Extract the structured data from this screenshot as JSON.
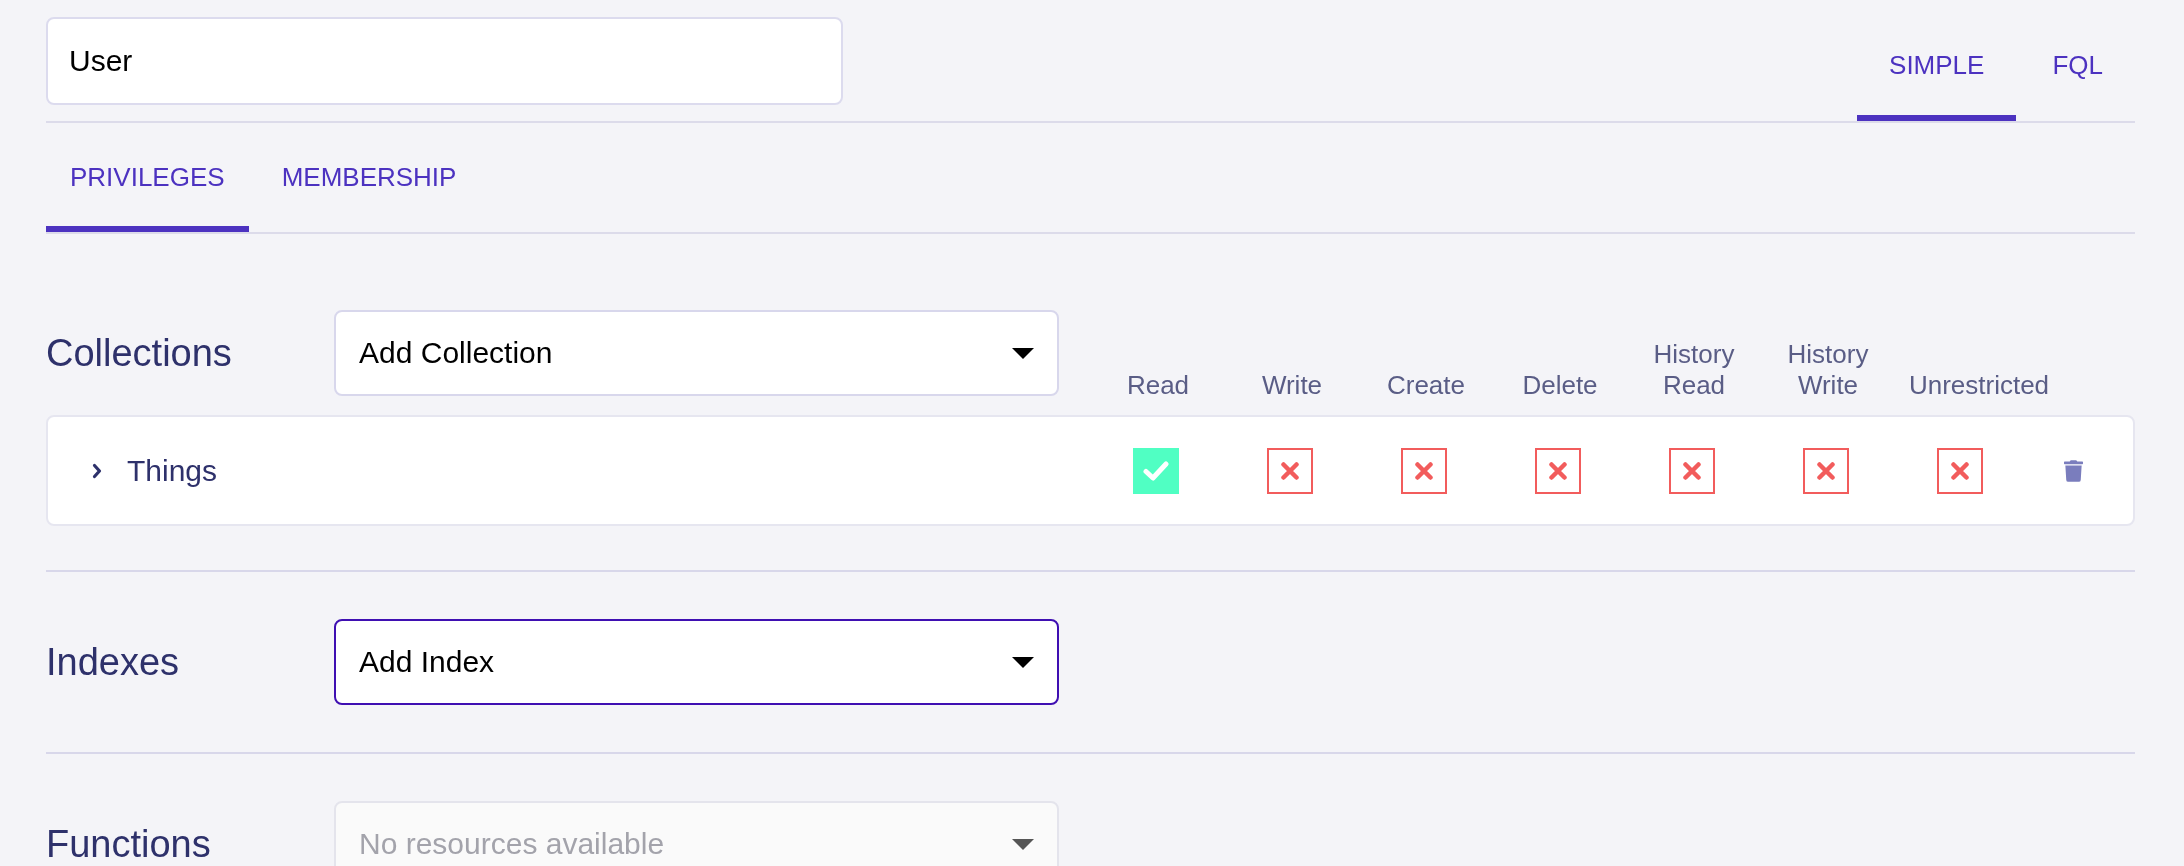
{
  "role_name": {
    "value": "User"
  },
  "mode_tabs": [
    {
      "label": "SIMPLE",
      "selected": true
    },
    {
      "label": "FQL",
      "selected": false
    }
  ],
  "tabs": [
    {
      "label": "PRIVILEGES",
      "selected": true
    },
    {
      "label": "MEMBERSHIP",
      "selected": false
    }
  ],
  "collections": {
    "title": "Collections",
    "select": {
      "value": "Add Collection",
      "focused": false
    },
    "columns": [
      "Read",
      "Write",
      "Create",
      "Delete",
      "History Read",
      "History Write",
      "Unrestricted"
    ],
    "rows": [
      {
        "name": "Things",
        "expanded": false,
        "permissions": [
          {
            "checked": true
          },
          {
            "checked": false
          },
          {
            "checked": false
          },
          {
            "checked": false
          },
          {
            "checked": false
          },
          {
            "checked": false
          },
          {
            "checked": false
          }
        ]
      }
    ]
  },
  "indexes": {
    "title": "Indexes",
    "select": {
      "value": "Add Index",
      "focused": true
    }
  },
  "functions": {
    "title": "Functions",
    "select": {
      "placeholder": "No resources available",
      "disabled": true
    }
  }
}
